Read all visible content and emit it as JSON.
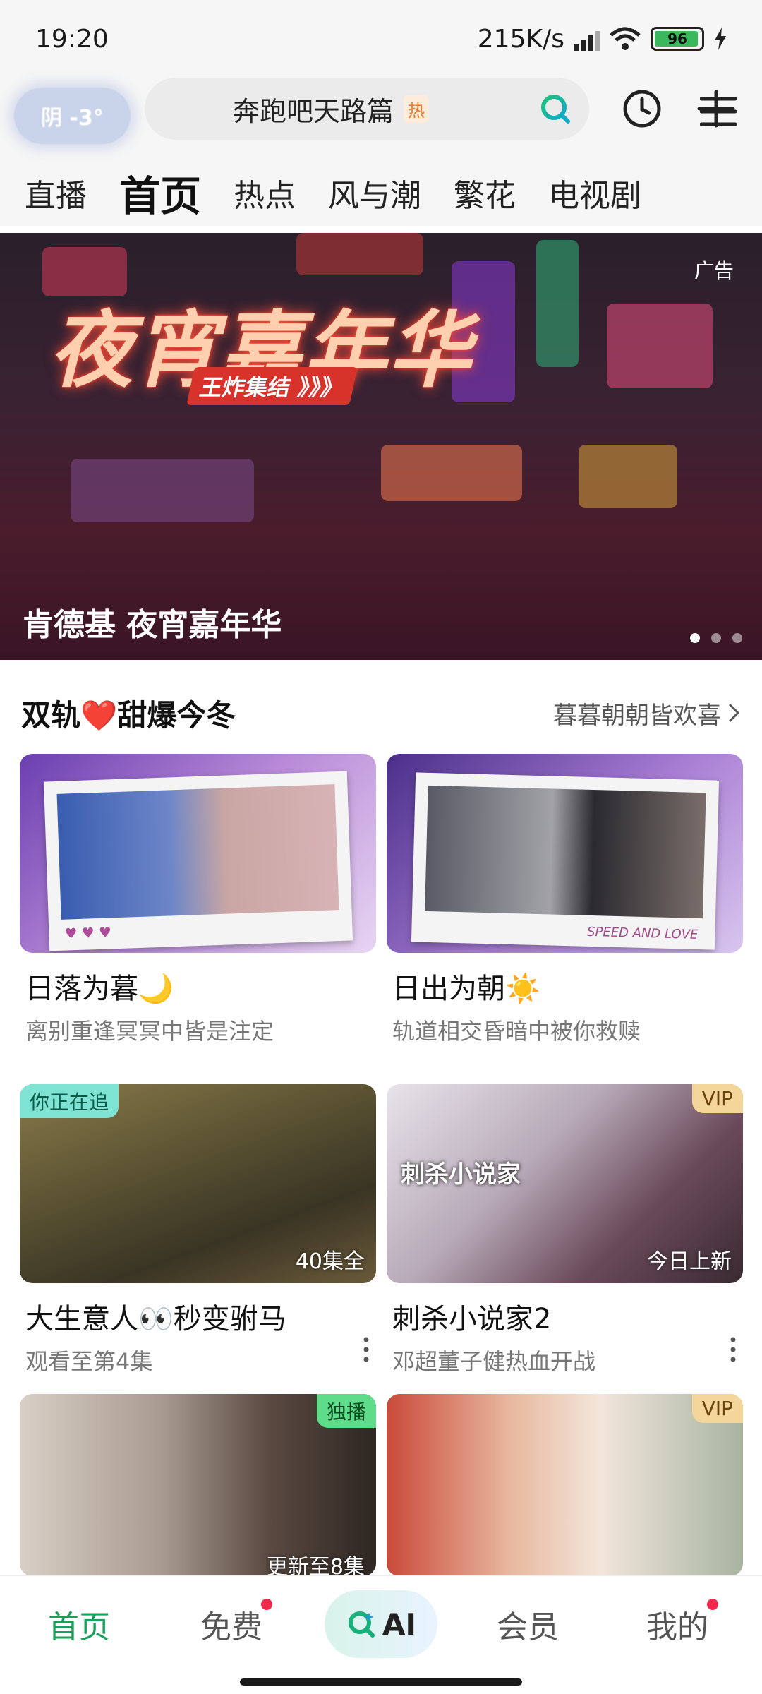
{
  "status_bar": {
    "time": "19:20",
    "net_speed": "215K/s",
    "battery": "96",
    "battery_level": 0.96
  },
  "header": {
    "weather": "阴 -3°",
    "search_text": "奔跑吧天路篇",
    "search_badge": "热"
  },
  "tabs": [
    "直播",
    "首页",
    "热点",
    "风与潮",
    "繁花",
    "电视剧"
  ],
  "active_tab": 1,
  "banner": {
    "ad_label": "广告",
    "logo_text": "夜宵嘉年华",
    "logo_sub": "王炸集结 》》》",
    "title": "肯德基 夜宵嘉年华",
    "slide_count": 3,
    "current_slide": 0
  },
  "section": {
    "title": "双轨❤️甜爆今冬",
    "more": "暮暮朝朝皆欢喜"
  },
  "cards": [
    {
      "title": "日落为暮🌙",
      "subtitle": "离别重逢冥冥中皆是注定"
    },
    {
      "title": "日出为朝☀️",
      "subtitle": "轨道相交昏暗中被你救赎"
    },
    {
      "title": "大生意人👀秒变驸马",
      "subtitle": "观看至第4集",
      "badge": "你正在追",
      "overlay": "40集全"
    },
    {
      "title": "刺杀小说家2",
      "subtitle": "邓超董子健热血开战",
      "badge": "VIP",
      "overlay": "今日上新",
      "poster_text": "刺杀小说家"
    },
    {
      "badge": "独播",
      "overlay": "更新至8集"
    },
    {
      "badge": "VIP"
    }
  ],
  "bottom_nav": {
    "home": "首页",
    "free": "免费",
    "ai": "AI",
    "member": "会员",
    "mine": "我的"
  },
  "colors": {
    "accent": "#18a058",
    "badge_red": "#f0294a",
    "vip_gold": "#f4d59a"
  }
}
